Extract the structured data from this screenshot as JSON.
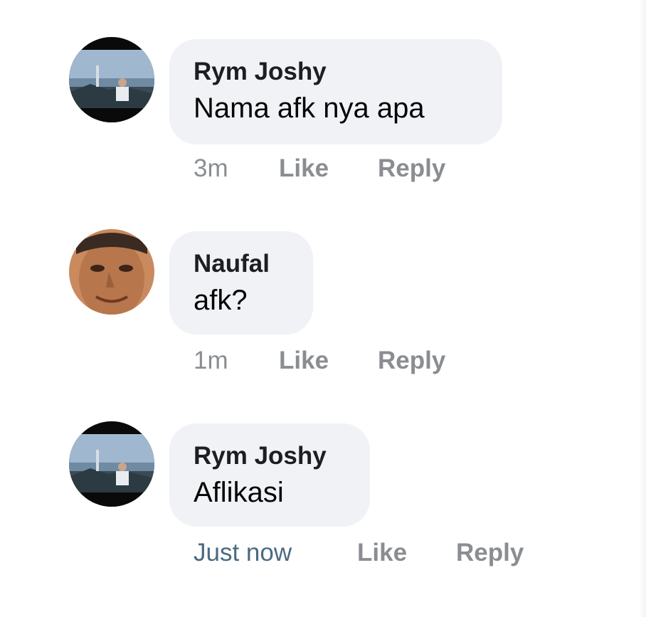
{
  "comments": [
    {
      "author": "Rym Joshy",
      "text": "Nama afk nya apa",
      "time": "3m",
      "like_label": "Like",
      "reply_label": "Reply"
    },
    {
      "author": "Naufal",
      "text": "afk?",
      "time": "1m",
      "like_label": "Like",
      "reply_label": "Reply"
    },
    {
      "author": "Rym Joshy",
      "text": "Aflikasi",
      "time": "Just now",
      "like_label": "Like",
      "reply_label": "Reply"
    }
  ],
  "colors": {
    "bubble": "#f0f2f5",
    "action_text": "#8a8d91",
    "recent_time": "#4b6a80"
  }
}
